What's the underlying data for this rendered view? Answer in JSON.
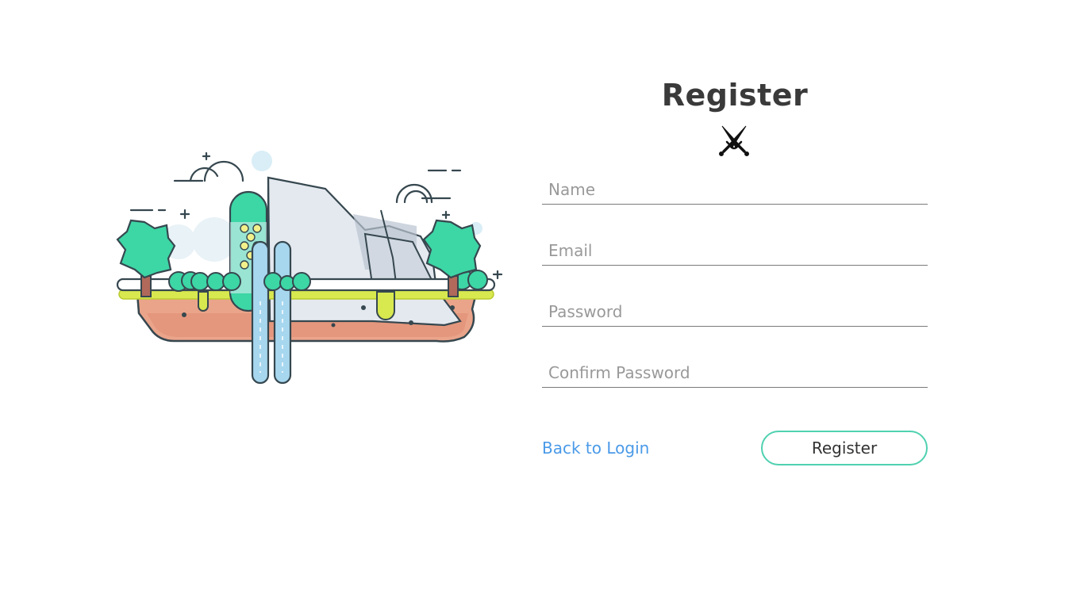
{
  "page": {
    "title": "Register"
  },
  "form": {
    "name_placeholder": "Name",
    "email_placeholder": "Email",
    "password_placeholder": "Password",
    "confirm_password_placeholder": "Confirm Password",
    "back_link_label": "Back to Login",
    "submit_label": "Register"
  },
  "icons": {
    "logo": "crossed-swords-icon"
  },
  "colors": {
    "accent": "#4fd1b0",
    "link": "#4a9ae8",
    "title": "#3a3a3a",
    "field_underline": "#7a7a7a"
  }
}
